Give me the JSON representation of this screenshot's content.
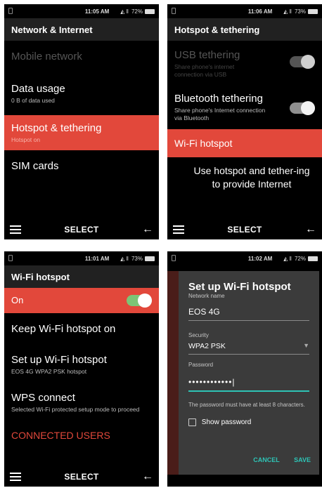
{
  "status": {
    "s1": {
      "time": "11:05 AM",
      "battery": "72%"
    },
    "s2": {
      "time": "11:06 AM",
      "battery": "73%"
    },
    "s3": {
      "time": "11:01 AM",
      "battery": "73%"
    },
    "s4": {
      "time": "11:02 AM",
      "battery": "72%"
    }
  },
  "softkeys": {
    "center": "SELECT",
    "back": "←"
  },
  "screen1": {
    "title": "Network & Internet",
    "items": [
      {
        "title": "Mobile network",
        "subtitle": ""
      },
      {
        "title": "Data usage",
        "subtitle": "0 B of data used"
      },
      {
        "title": "Hotspot & tethering",
        "subtitle": "Hotspot on"
      },
      {
        "title": "SIM cards",
        "subtitle": ""
      }
    ]
  },
  "screen2": {
    "title": "Hotspot & tethering",
    "items": [
      {
        "title": "USB tethering",
        "subtitle": "Share phone's internet connection via USB"
      },
      {
        "title": "Bluetooth tethering",
        "subtitle": "Share phone's Internet connection via Bluetooth"
      },
      {
        "title": "Wi-Fi hotspot",
        "subtitle": ""
      }
    ],
    "hint": "Use hotspot and tether-ing to provide Internet"
  },
  "screen3": {
    "title": "Wi-Fi hotspot",
    "items": [
      {
        "title": "On",
        "subtitle": ""
      },
      {
        "title": "Keep Wi-Fi hotspot on",
        "subtitle": ""
      },
      {
        "title": "Set up Wi-Fi hotspot",
        "subtitle": "EOS 4G WPA2 PSK hotspot"
      },
      {
        "title": "WPS connect",
        "subtitle": "Selected Wi-Fi protected setup mode to proceed"
      }
    ],
    "section": "CONNECTED USERS"
  },
  "screen4": {
    "dialog_title": "Set up Wi-Fi hotspot",
    "network_name_label": "Network name",
    "network_name_value": "EOS 4G",
    "security_label": "Security",
    "security_value": "WPA2 PSK",
    "password_label": "Password",
    "password_value": "••••••••••••|",
    "password_hint": "The password must have at least 8 characters.",
    "show_password": "Show password",
    "cancel": "CANCEL",
    "save": "SAVE"
  }
}
